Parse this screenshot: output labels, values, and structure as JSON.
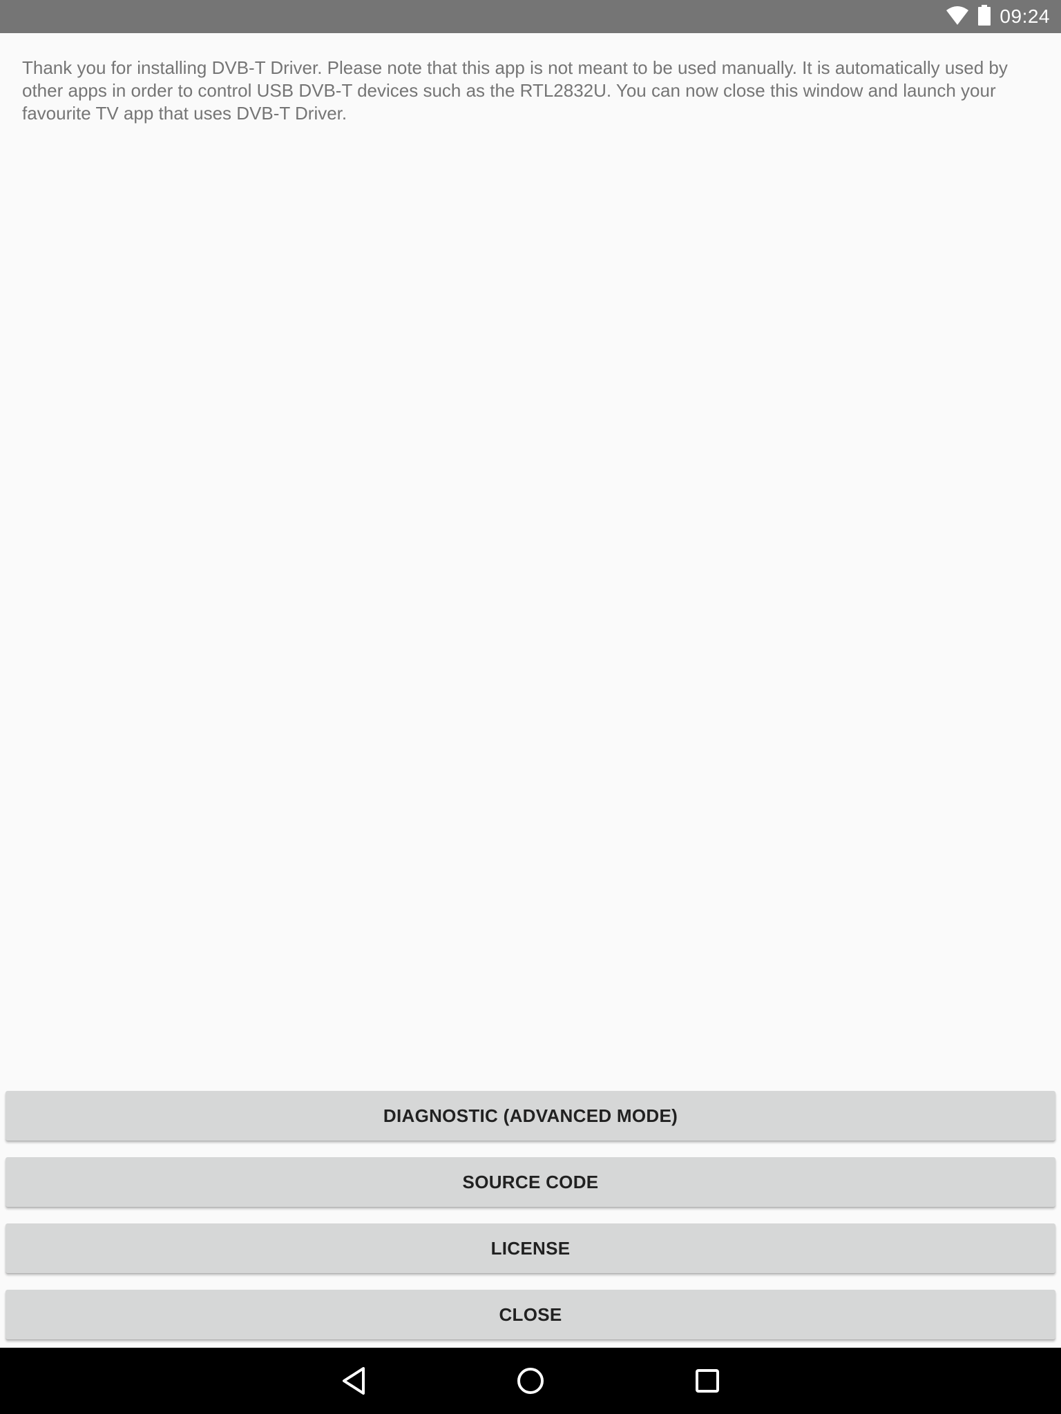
{
  "status_bar": {
    "time": "09:24",
    "icons": [
      "wifi-icon",
      "battery-icon"
    ]
  },
  "main": {
    "message": "Thank you for installing DVB-T Driver. Please note that this app is not meant to be used manually. It is automatically used by other apps in order to control USB DVB-T devices such as the RTL2832U. You can now close this window and launch your favourite TV app that uses DVB-T Driver."
  },
  "buttons": {
    "diagnostic_label": "DIAGNOSTIC (ADVANCED MODE)",
    "source_code_label": "SOURCE CODE",
    "license_label": "LICENSE",
    "close_label": "CLOSE"
  },
  "nav_bar": {
    "icons": [
      "back-icon",
      "home-icon",
      "recents-icon"
    ]
  },
  "colors": {
    "status_bar": "#757575",
    "background": "#fafafa",
    "button": "#d6d7d7",
    "button_text": "#212121",
    "message_text": "#757575",
    "nav_bar": "#000000"
  }
}
